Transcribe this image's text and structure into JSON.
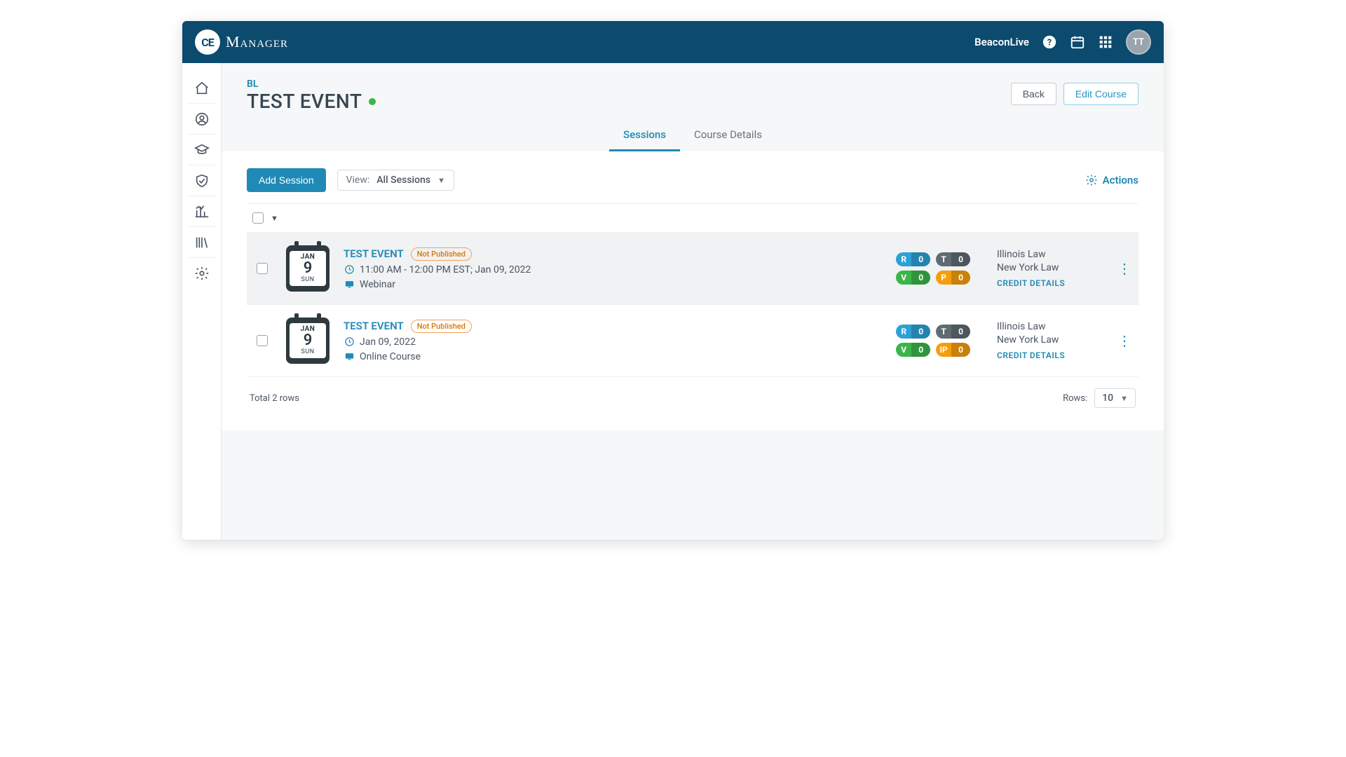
{
  "header": {
    "logo_badge": "CE",
    "logo_text": "Manager",
    "org": "BeaconLive",
    "avatar": "TT"
  },
  "page": {
    "crumb": "BL",
    "title": "TEST EVENT",
    "back_label": "Back",
    "edit_label": "Edit Course"
  },
  "tabs": [
    {
      "label": "Sessions",
      "active": true
    },
    {
      "label": "Course Details",
      "active": false
    }
  ],
  "toolbar": {
    "add_label": "Add Session",
    "view_label": "View:",
    "view_value": "All Sessions",
    "actions_label": "Actions"
  },
  "sessions": [
    {
      "cal": {
        "month": "JAN",
        "day": "9",
        "dow": "SUN"
      },
      "title": "TEST EVENT",
      "status": "Not Published",
      "time": "11:00 AM - 12:00 PM  EST; Jan 09, 2022",
      "mode": "Webinar",
      "highlight": true,
      "stats": {
        "R": "0",
        "T": "0",
        "V": "0",
        "extra_key": "P",
        "extra_val": "0"
      },
      "jurisdictions": [
        "Illinois Law",
        "New York Law"
      ],
      "credit_link": "CREDIT DETAILS"
    },
    {
      "cal": {
        "month": "JAN",
        "day": "9",
        "dow": "SUN"
      },
      "title": "TEST EVENT",
      "status": "Not Published",
      "time": "Jan 09, 2022",
      "mode": "Online Course",
      "highlight": false,
      "stats": {
        "R": "0",
        "T": "0",
        "V": "0",
        "extra_key": "IP",
        "extra_val": "0"
      },
      "jurisdictions": [
        "Illinois Law",
        "New York Law"
      ],
      "credit_link": "CREDIT DETAILS"
    }
  ],
  "footer": {
    "total": "Total 2 rows",
    "rows_label": "Rows:",
    "rows_value": "10"
  }
}
